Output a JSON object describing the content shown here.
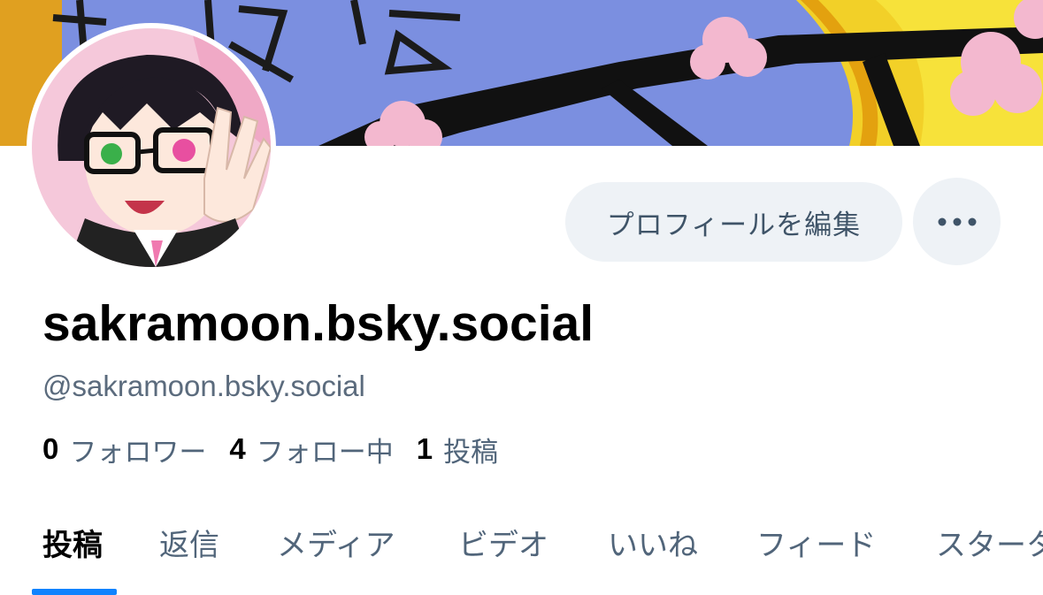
{
  "profile": {
    "display_name": "sakramoon.bsky.social",
    "handle": "@sakramoon.bsky.social"
  },
  "actions": {
    "edit_profile_label": "プロフィールを編集",
    "more_icon": "ellipsis-icon"
  },
  "stats": {
    "followers_count": "0",
    "followers_label": "フォロワー",
    "following_count": "4",
    "following_label": "フォロー中",
    "posts_count": "1",
    "posts_label": "投稿"
  },
  "tabs": [
    {
      "label": "投稿",
      "active": true
    },
    {
      "label": "返信"
    },
    {
      "label": "メディア"
    },
    {
      "label": "ビデオ"
    },
    {
      "label": "いいね"
    },
    {
      "label": "フィード"
    },
    {
      "label": "スターターパック"
    }
  ],
  "colors": {
    "accent": "#1083fe",
    "secondary_text": "#51657a",
    "button_bg": "#eef2f6"
  }
}
